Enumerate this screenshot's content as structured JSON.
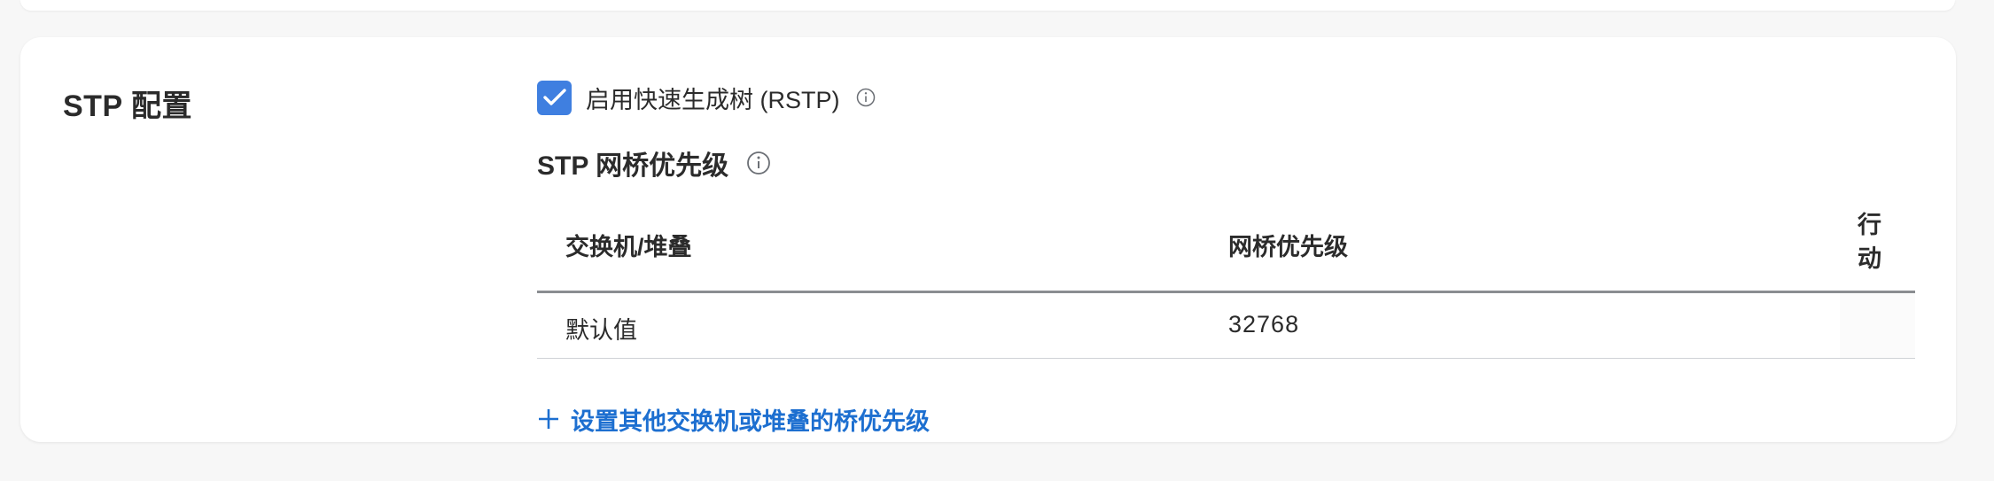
{
  "section": {
    "title": "STP 配置"
  },
  "rstp": {
    "checked": true,
    "label": "启用快速生成树 (RSTP)",
    "info_icon": "info-icon"
  },
  "bridge_priority": {
    "title": "STP 网桥优先级",
    "info_icon": "info-icon",
    "table": {
      "headers": {
        "switch": "交换机/堆叠",
        "priority": "网桥优先级",
        "action": "行动"
      },
      "rows": [
        {
          "switch": "默认值",
          "priority": "32768",
          "action": ""
        }
      ]
    },
    "add_link": {
      "icon": "plus-icon",
      "label": "设置其他交换机或堆叠的桥优先级"
    }
  },
  "colors": {
    "accent": "#3f7fe0",
    "link": "#1d6fd0",
    "text": "#2b2b2b",
    "header_border": "#8a8d91"
  }
}
